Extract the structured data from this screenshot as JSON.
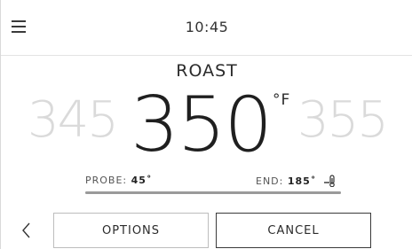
{
  "header": {
    "time": "10:45"
  },
  "oven": {
    "mode": "ROAST",
    "temp_prev": "345",
    "temp_current": "350",
    "temp_unit": "°F",
    "temp_next": "355"
  },
  "probe": {
    "probe_label": "PROBE:",
    "probe_value": "45˚",
    "end_label": "END:",
    "end_value": "185˚",
    "progress_fraction": 1.0
  },
  "actions": {
    "options_label": "OPTIONS",
    "cancel_label": "CANCEL"
  },
  "icons": [
    "menu-icon",
    "chevron-left-icon",
    "thermometer-probe-icon"
  ]
}
